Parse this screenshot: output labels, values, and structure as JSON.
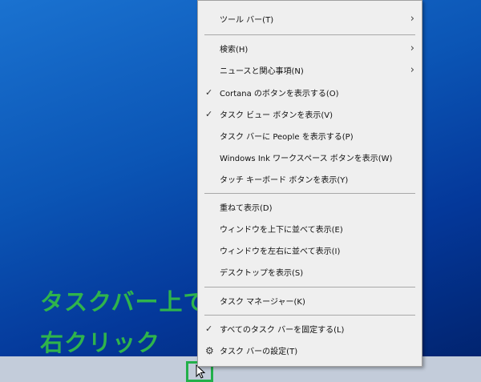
{
  "annotation": {
    "line1": "タスクバー上で",
    "line2": "右クリック"
  },
  "menu": {
    "items": [
      {
        "label": "ツール バー(T)",
        "submenu": true
      },
      {
        "label": "検索(H)",
        "submenu": true
      },
      {
        "label": "ニュースと関心事項(N)",
        "submenu": true
      },
      {
        "label": "Cortana のボタンを表示する(O)",
        "checked": true
      },
      {
        "label": "タスク ビュー ボタンを表示(V)",
        "checked": true
      },
      {
        "label": "タスク バーに People を表示する(P)"
      },
      {
        "label": "Windows Ink ワークスペース ボタンを表示(W)"
      },
      {
        "label": "タッチ キーボード ボタンを表示(Y)"
      },
      {
        "label": "重ねて表示(D)"
      },
      {
        "label": "ウィンドウを上下に並べて表示(E)"
      },
      {
        "label": "ウィンドウを左右に並べて表示(I)"
      },
      {
        "label": "デスクトップを表示(S)"
      },
      {
        "label": "タスク マネージャー(K)"
      },
      {
        "label": "すべてのタスク バーを固定する(L)",
        "checked": true
      },
      {
        "label": "タスク バーの設定(T)",
        "icon": "gear-icon"
      }
    ],
    "check_glyph": "✓",
    "arrow_glyph": "›",
    "gear_glyph": "⚙"
  }
}
